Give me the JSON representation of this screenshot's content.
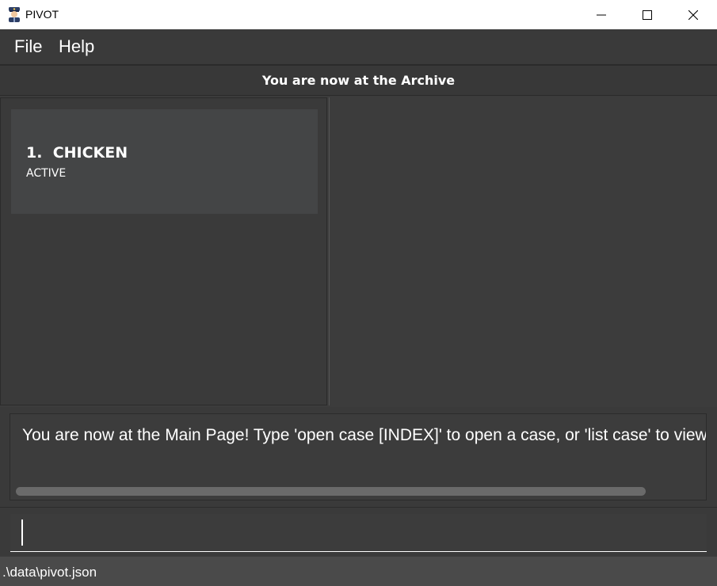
{
  "window": {
    "title": "PIVOT"
  },
  "icons": {
    "app": "police-officer-icon",
    "minimize": "minimize-icon",
    "maximize": "maximize-icon",
    "close": "close-icon"
  },
  "menu": {
    "file_label": "File",
    "help_label": "Help"
  },
  "header": {
    "status": "You are now at the Archive"
  },
  "cases": [
    {
      "index": "1.",
      "title": "CHICKEN",
      "status": "ACTIVE"
    }
  ],
  "result": {
    "message": "You are now at the Main Page! Type 'open case [INDEX]' to open a case, or 'list case' to view all",
    "scroll_position": 0.0
  },
  "command": {
    "value": "",
    "placeholder": ""
  },
  "statusbar": {
    "path": ".\\data\\pivot.json"
  },
  "colors": {
    "background": "#3c3c3c",
    "card": "#444546",
    "text": "#ffffff",
    "titlebar": "#ffffff"
  }
}
